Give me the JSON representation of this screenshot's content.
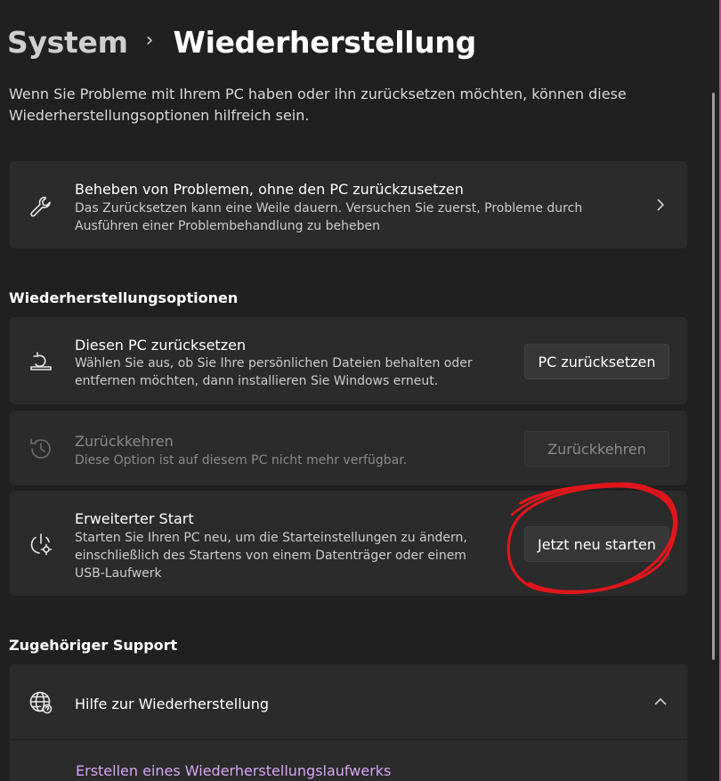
{
  "breadcrumb": {
    "parent": "System",
    "separator": "›",
    "current": "Wiederherstellung"
  },
  "intro": "Wenn Sie Probleme mit Ihrem PC haben oder ihn zurücksetzen möchten, können diese Wiederherstellungsoptionen hilfreich sein.",
  "troubleshoot": {
    "icon": "wrench-icon",
    "title": "Beheben von Problemen, ohne den PC zurückzusetzen",
    "description": "Das Zurücksetzen kann eine Weile dauern. Versuchen Sie zuerst, Probleme durch Ausführen einer Problembehandlung zu beheben"
  },
  "recovery_options": {
    "heading": "Wiederherstellungsoptionen",
    "items": [
      {
        "icon": "reset-pc-icon",
        "title": "Diesen PC zurücksetzen",
        "description": "Wählen Sie aus, ob Sie Ihre persönlichen Dateien behalten oder entfernen möchten, dann installieren Sie Windows erneut.",
        "button": "PC zurücksetzen",
        "enabled": true
      },
      {
        "icon": "history-icon",
        "title": "Zurückkehren",
        "description": "Diese Option ist auf diesem PC nicht mehr verfügbar.",
        "button": "Zurückkehren",
        "enabled": false
      },
      {
        "icon": "advanced-startup-icon",
        "title": "Erweiterter Start",
        "description": "Starten Sie Ihren PC neu, um die Starteinstellungen zu ändern, einschließlich des Startens von einem Datenträger oder einem USB-Laufwerk",
        "button": "Jetzt neu starten",
        "enabled": true
      }
    ]
  },
  "support": {
    "heading": "Zugehöriger Support",
    "item": {
      "icon": "globe-help-icon",
      "title": "Hilfe zur Wiederherstellung",
      "expanded": true
    },
    "link": "Erstellen eines Wiederherstellungslaufwerks"
  },
  "colors": {
    "background": "#202020",
    "card": "#2b2b2b",
    "link": "#d7a6f5",
    "annotation": "#e0161c"
  }
}
